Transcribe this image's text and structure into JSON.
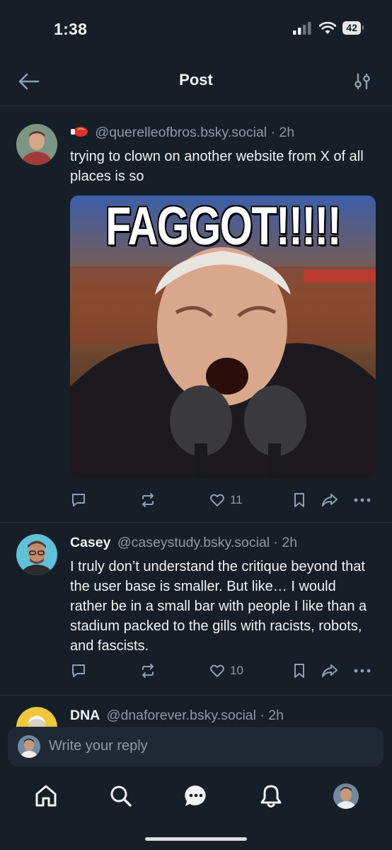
{
  "status": {
    "time": "1:38",
    "battery": "42"
  },
  "header": {
    "title": "Post"
  },
  "posts": [
    {
      "display_name": "",
      "handle": "@querelleofbros.bsky.social",
      "time": "· 2h",
      "text": "trying to clown on another website from X of all places is so",
      "image_caption": "FAGGOT!!!!!",
      "likes": "11"
    },
    {
      "display_name": "Casey",
      "handle": "@caseystudy.bsky.social",
      "time": "· 2h",
      "text": "I truly don’t understand the critique beyond that the user base is smaller. But like… I would rather be in a small bar with people I like than a stadium packed to the gills with racists, robots, and fascists.",
      "likes": "10"
    },
    {
      "display_name": "DNA",
      "handle": "@dnaforever.bsky.social",
      "time": "· 2h"
    }
  ],
  "reply": {
    "placeholder": "Write your reply"
  },
  "colors": {
    "background": "#161e27",
    "muted": "#8e99a5",
    "text": "#f1f3f5",
    "divider": "#263140"
  },
  "icons": [
    "back-arrow-icon",
    "filter-icon",
    "reply-icon",
    "repost-icon",
    "heart-icon",
    "bookmark-icon",
    "share-icon",
    "more-icon",
    "home-icon",
    "search-icon",
    "chat-icon",
    "bell-icon",
    "profile-icon"
  ]
}
